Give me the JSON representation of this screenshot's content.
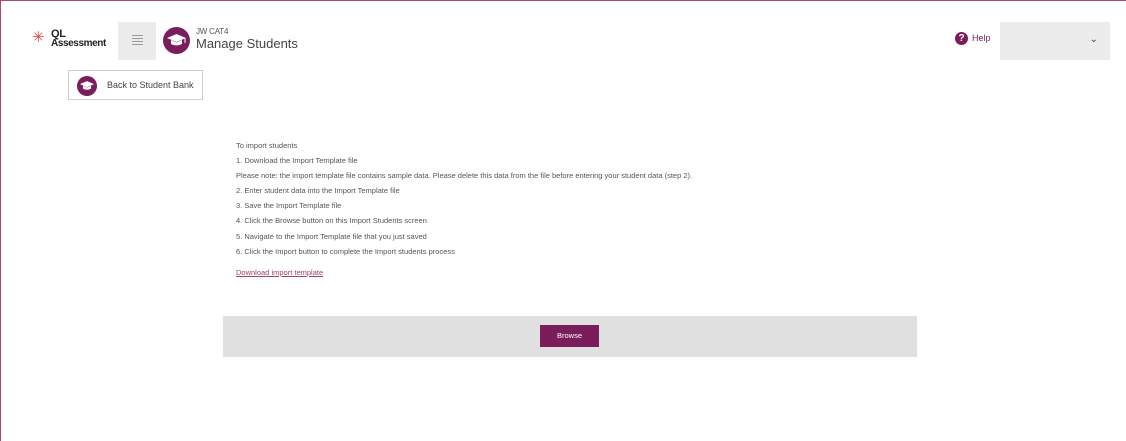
{
  "header": {
    "logo": {
      "line1": "QL",
      "line2": "Assessment"
    },
    "menu_icon": "hamburger-icon",
    "page_icon": "graduation-cap-icon",
    "subtitle": "JW CAT4",
    "title": "Manage Students",
    "help_label": "Help",
    "user_dropdown_icon": "chevron-down-icon"
  },
  "back_button": {
    "label": "Back to Student Bank",
    "icon": "graduation-cap-icon"
  },
  "instructions": {
    "lines": [
      "To import students",
      "1. Download the Import Template file",
      "Please note: the import template file contains sample data. Please delete this data from the file before entering your student data (step 2).",
      "2. Enter student data into the Import Template file",
      "3. Save the Import Template file",
      "4. Click the Browse button on this Import Students screen",
      "5. Navigate to the Import Template file that you just saved",
      "6. Click the Import button to complete the Import students process"
    ],
    "download_link": "Download import template"
  },
  "browse": {
    "label": "Browse"
  },
  "colors": {
    "accent": "#7a1e5b",
    "frame_border": "#b0466f",
    "browse_bar": "#e0e0e0"
  }
}
